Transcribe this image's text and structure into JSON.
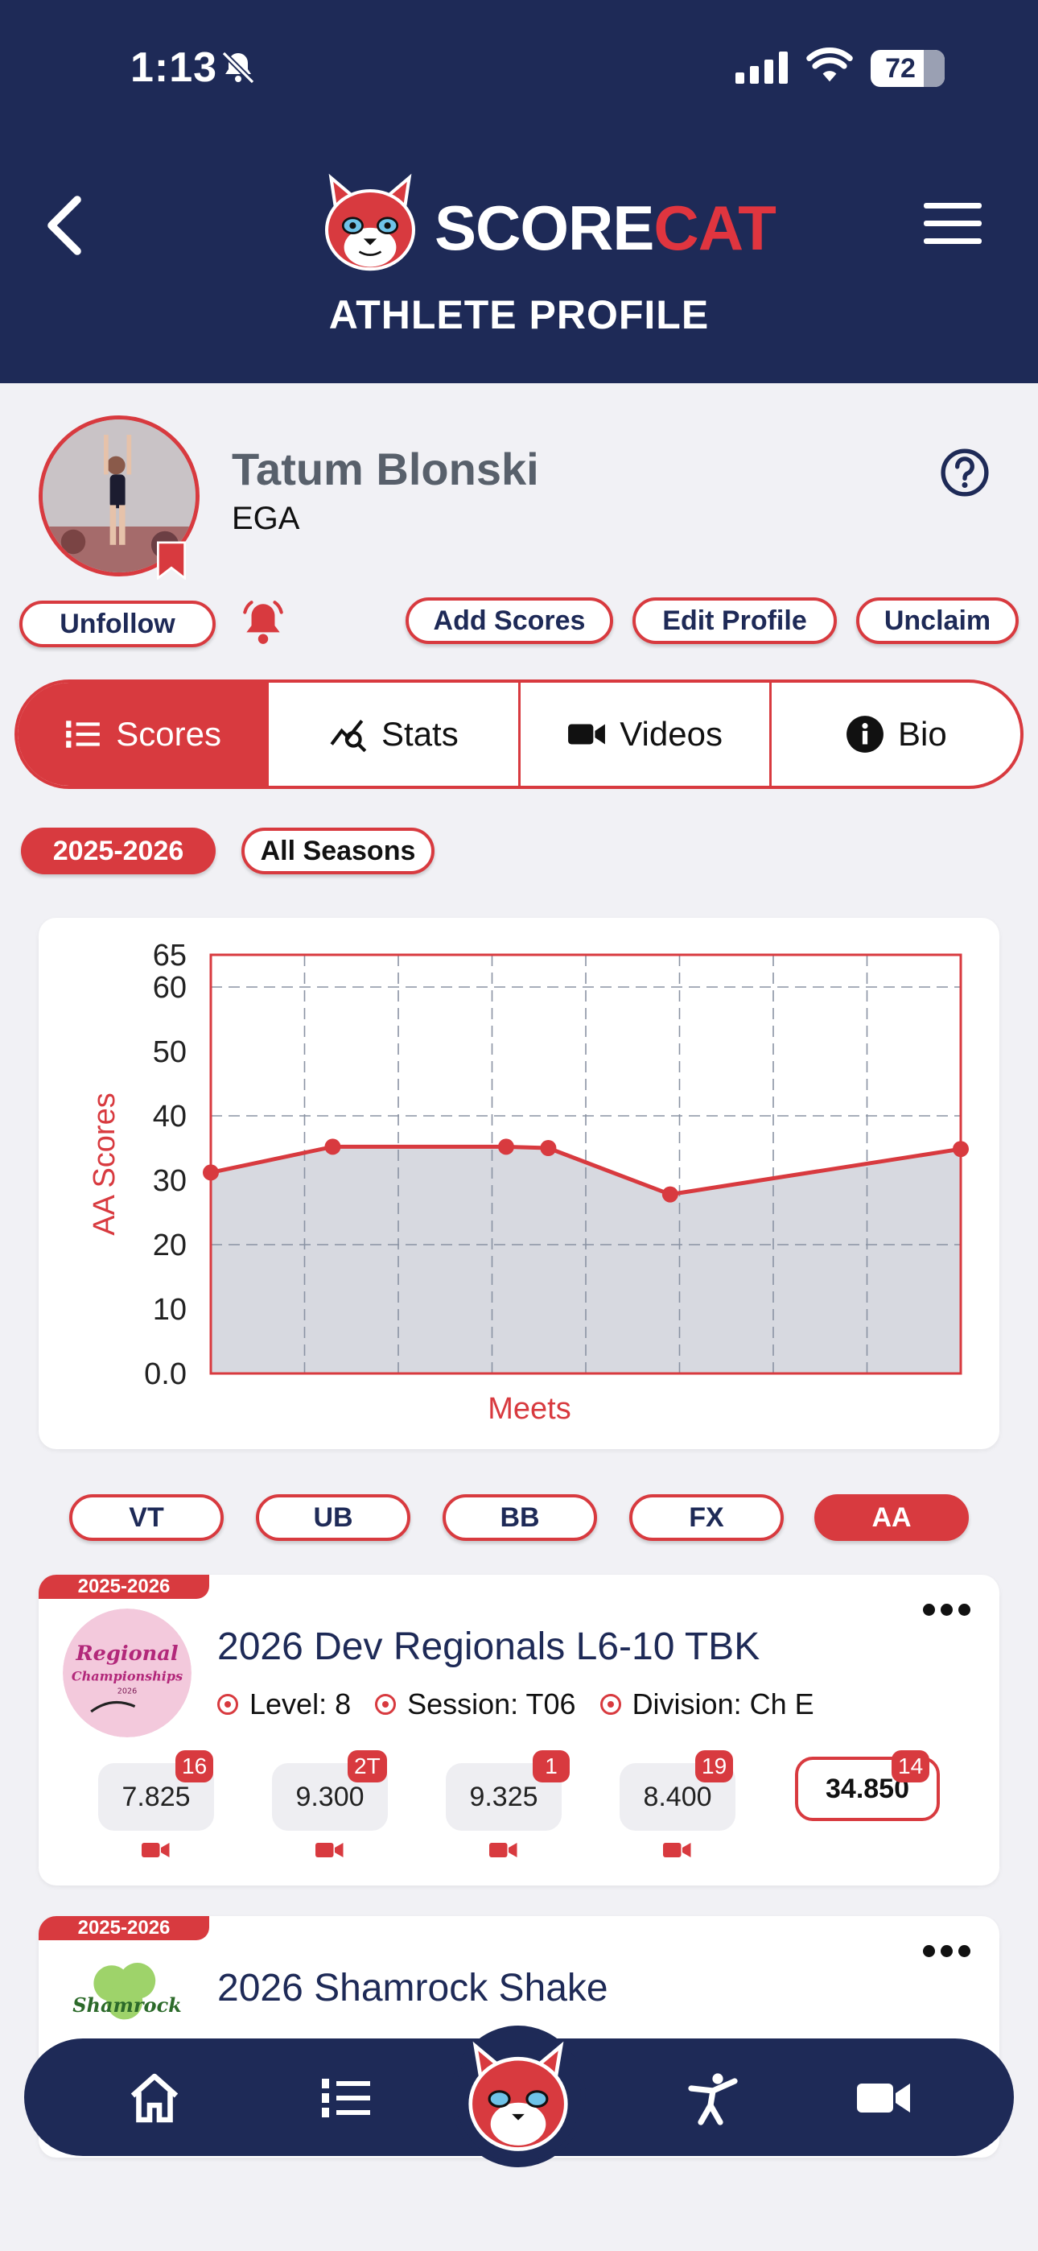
{
  "status_bar": {
    "time": "1:13",
    "battery": "72",
    "battery_level": 0.72
  },
  "header": {
    "logo_score": "SCORE",
    "logo_cat": "CAT",
    "title": "ATHLETE PROFILE"
  },
  "profile": {
    "name": "Tatum Blonski",
    "club": "EGA"
  },
  "actions": {
    "unfollow": "Unfollow",
    "add_scores": "Add Scores",
    "edit_profile": "Edit Profile",
    "unclaim": "Unclaim"
  },
  "tabs": [
    {
      "label": "Scores",
      "icon": "list-icon",
      "active": true
    },
    {
      "label": "Stats",
      "icon": "stats-icon",
      "active": false
    },
    {
      "label": "Videos",
      "icon": "video-icon",
      "active": false
    },
    {
      "label": "Bio",
      "icon": "info-icon",
      "active": false
    }
  ],
  "seasons": {
    "current": "2025-2026",
    "all": "All Seasons"
  },
  "chart_data": {
    "type": "area",
    "ylabel": "AA Scores",
    "xlabel": "Meets",
    "ylim": [
      0,
      65
    ],
    "yticks": [
      "0.0",
      "10",
      "20",
      "30",
      "40",
      "50",
      "60",
      "65"
    ],
    "ytick_values": [
      0,
      10,
      20,
      30,
      40,
      50,
      60,
      65
    ],
    "x": [
      0,
      1.3,
      3.15,
      3.6,
      4.9,
      8
    ],
    "xlim": [
      0,
      8
    ],
    "values": [
      31.2,
      35.2,
      35.2,
      35.0,
      27.8,
      34.85
    ],
    "grid": true,
    "line_color": "#d83a3f",
    "fill_color": "#d7d9e0"
  },
  "event_filters": [
    {
      "label": "VT",
      "active": false
    },
    {
      "label": "UB",
      "active": false
    },
    {
      "label": "BB",
      "active": false
    },
    {
      "label": "FX",
      "active": false
    },
    {
      "label": "AA",
      "active": true
    }
  ],
  "meets": [
    {
      "season": "2025-2026",
      "name": "2026 Dev Regionals L6-10 TBK",
      "level": "Level: 8",
      "session": "Session: T06",
      "division": "Division: Ch E",
      "logo_text": "Regional Championships",
      "scores": [
        {
          "score": "7.825",
          "rank": "16"
        },
        {
          "score": "9.300",
          "rank": "2T"
        },
        {
          "score": "9.325",
          "rank": "1"
        },
        {
          "score": "8.400",
          "rank": "19"
        }
      ],
      "total": {
        "score": "34.850",
        "rank": "14"
      }
    },
    {
      "season": "2025-2026",
      "name": "2026 Shamrock Shake",
      "logo_text": "Shamrock"
    }
  ],
  "colors": {
    "navy": "#1e2a57",
    "red": "#d83a3f",
    "bg": "#f1f1f5"
  },
  "bottom_nav": [
    "home-icon",
    "list-icon",
    "scorecat-logo",
    "gymnast-icon",
    "video-icon"
  ]
}
